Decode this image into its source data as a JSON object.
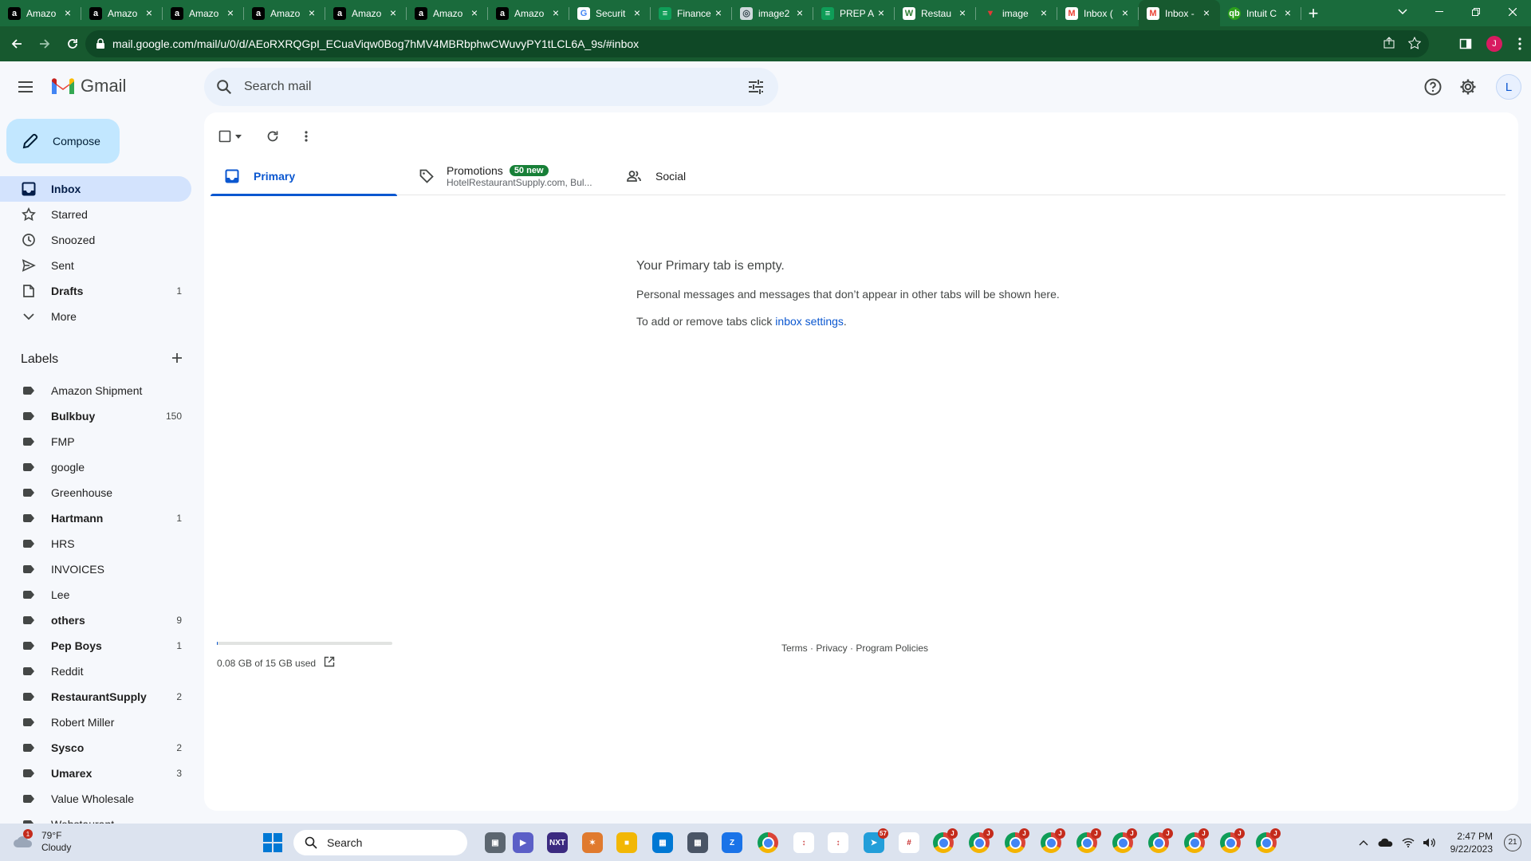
{
  "browser": {
    "tabs": [
      {
        "label": "Amazo",
        "icon": "amazon-icon"
      },
      {
        "label": "Amazo",
        "icon": "amazon-icon"
      },
      {
        "label": "Amazo",
        "icon": "amazon-icon"
      },
      {
        "label": "Amazo",
        "icon": "amazon-icon"
      },
      {
        "label": "Amazo",
        "icon": "amazon-icon"
      },
      {
        "label": "Amazo",
        "icon": "amazon-icon"
      },
      {
        "label": "Amazo",
        "icon": "amazon-icon"
      },
      {
        "label": "Securit",
        "icon": "google-icon"
      },
      {
        "label": "Finance",
        "icon": "sheets-icon"
      },
      {
        "label": "image2",
        "icon": "globe-icon"
      },
      {
        "label": "PREP A",
        "icon": "sheets-icon"
      },
      {
        "label": "Restau",
        "icon": "webstaurant-icon"
      },
      {
        "label": "image",
        "icon": "image-icon"
      },
      {
        "label": "Inbox (",
        "icon": "gmail-icon"
      },
      {
        "label": "Inbox -",
        "icon": "gmail-icon"
      },
      {
        "label": "Intuit C",
        "icon": "intuit-icon"
      }
    ],
    "active_tab_index": 14,
    "url": "mail.google.com/mail/u/0/d/AEoRXRQGpI_ECuaViqw0Bog7hMV4MBRbphwCWuvyPY1tLCL6A_9s/#inbox",
    "profile_initial": "J"
  },
  "gmail": {
    "product_name": "Gmail",
    "search_placeholder": "Search mail",
    "account_initial": "L",
    "compose_label": "Compose",
    "nav": [
      {
        "label": "Inbox",
        "count": "",
        "icon": "inbox-icon",
        "active": true,
        "bold": true
      },
      {
        "label": "Starred",
        "count": "",
        "icon": "star-icon",
        "active": false,
        "bold": false
      },
      {
        "label": "Snoozed",
        "count": "",
        "icon": "clock-icon",
        "active": false,
        "bold": false
      },
      {
        "label": "Sent",
        "count": "",
        "icon": "send-icon",
        "active": false,
        "bold": false
      },
      {
        "label": "Drafts",
        "count": "1",
        "icon": "draft-icon",
        "active": false,
        "bold": true
      },
      {
        "label": "More",
        "count": "",
        "icon": "chevron-down-icon",
        "active": false,
        "bold": false
      }
    ],
    "labels_heading": "Labels",
    "labels": [
      {
        "label": "Amazon Shipment",
        "count": "",
        "bold": false
      },
      {
        "label": "Bulkbuy",
        "count": "150",
        "bold": true
      },
      {
        "label": "FMP",
        "count": "",
        "bold": false
      },
      {
        "label": "google",
        "count": "",
        "bold": false
      },
      {
        "label": "Greenhouse",
        "count": "",
        "bold": false
      },
      {
        "label": "Hartmann",
        "count": "1",
        "bold": true
      },
      {
        "label": "HRS",
        "count": "",
        "bold": false
      },
      {
        "label": "INVOICES",
        "count": "",
        "bold": false
      },
      {
        "label": "Lee",
        "count": "",
        "bold": false
      },
      {
        "label": "others",
        "count": "9",
        "bold": true
      },
      {
        "label": "Pep Boys",
        "count": "1",
        "bold": true
      },
      {
        "label": "Reddit",
        "count": "",
        "bold": false
      },
      {
        "label": "RestaurantSupply",
        "count": "2",
        "bold": true
      },
      {
        "label": "Robert Miller",
        "count": "",
        "bold": false
      },
      {
        "label": "Sysco",
        "count": "2",
        "bold": true
      },
      {
        "label": "Umarex",
        "count": "3",
        "bold": true
      },
      {
        "label": "Value Wholesale",
        "count": "",
        "bold": false
      },
      {
        "label": "Webstaurant",
        "count": "",
        "bold": false
      }
    ],
    "tabs": {
      "primary": "Primary",
      "promotions": "Promotions",
      "promotions_badge": "50 new",
      "promotions_sub": "HotelRestaurantSupply.com, Bul...",
      "social": "Social"
    },
    "empty_state": {
      "title": "Your Primary tab is empty.",
      "line1": "Personal messages and messages that don’t appear in other tabs will be shown here.",
      "line2_prefix": "To add or remove tabs click ",
      "line2_link": "inbox settings",
      "line2_suffix": "."
    },
    "storage": {
      "text": "0.08 GB of 15 GB used",
      "used_fraction": 0.0053
    },
    "footer": {
      "terms": "Terms",
      "privacy": "Privacy",
      "policies": "Program Policies",
      "sep": " · "
    }
  },
  "taskbar": {
    "weather_temp": "79°F",
    "weather_desc": "Cloudy",
    "weather_badge": "1",
    "search_label": "Search",
    "time": "2:47 PM",
    "date": "9/22/2023",
    "notifications": "21",
    "badges": {
      "telegram": "57",
      "chrome": "J"
    }
  },
  "colors": {
    "chrome_frame": "#1a6b3c",
    "gmail_accent": "#0b57d0",
    "compose_bg": "#c2e7ff",
    "promo_badge": "#188038"
  }
}
